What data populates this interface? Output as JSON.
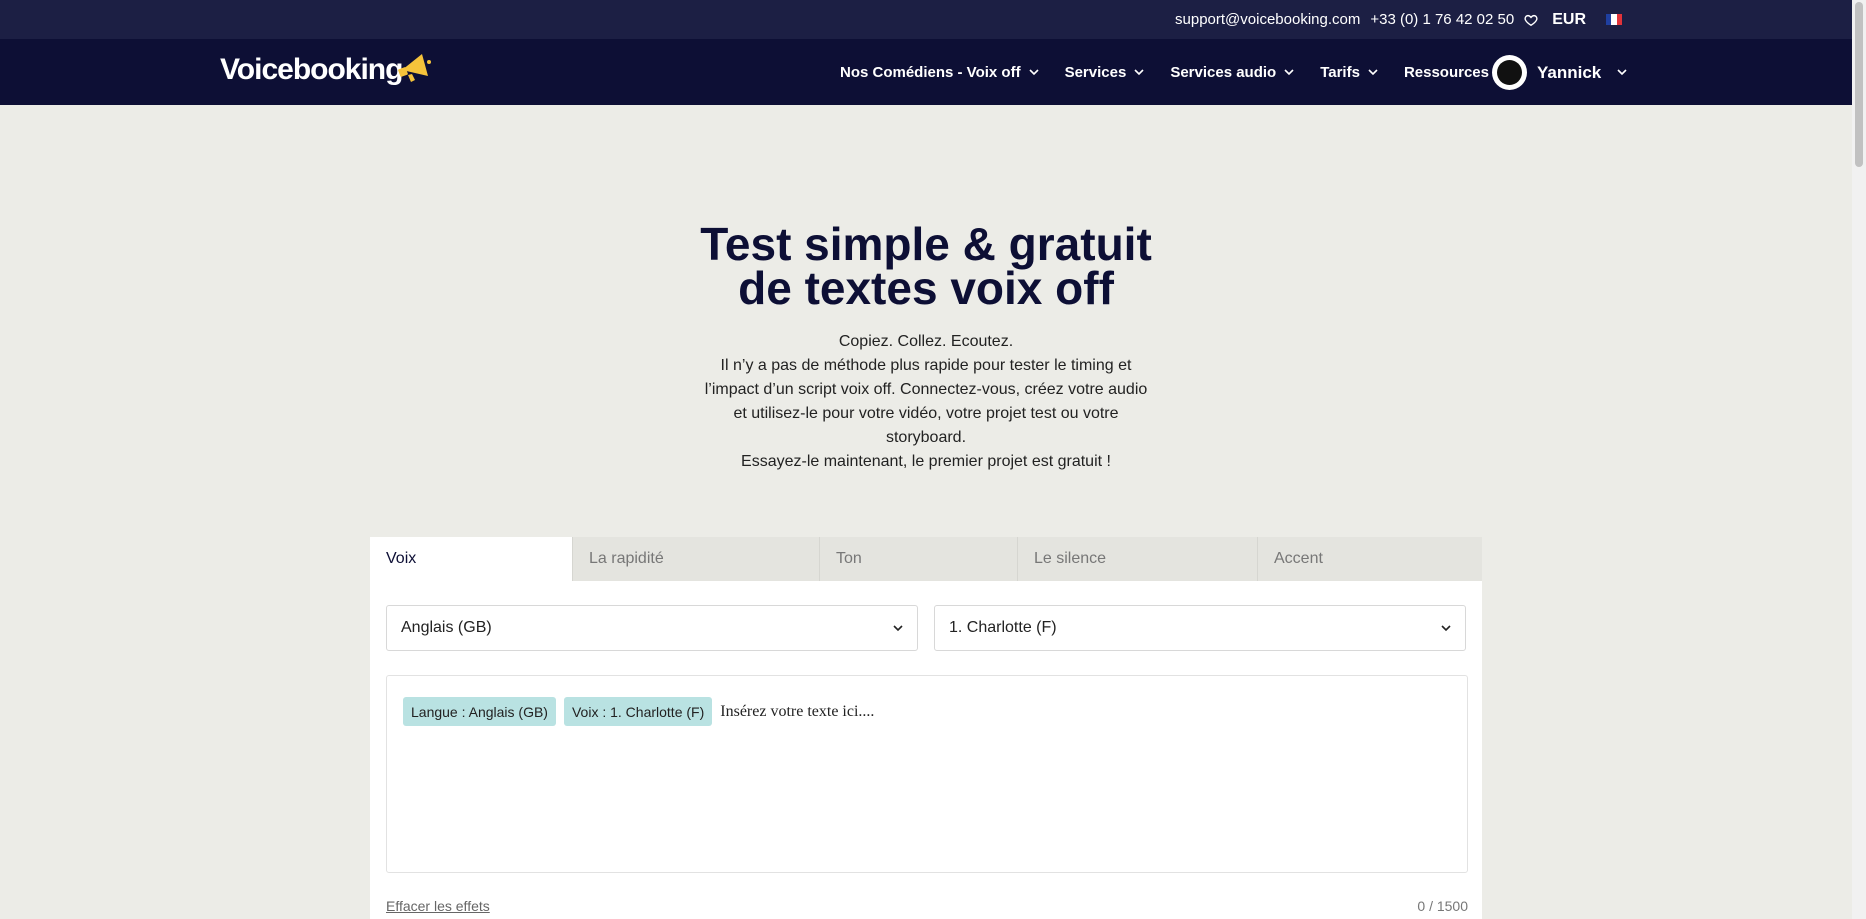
{
  "topbar": {
    "email": "support@voicebooking.com",
    "phone": "+33 (0) 1 76 42 02 50",
    "currency": "EUR"
  },
  "logo": {
    "text": "Voicebooking"
  },
  "nav": {
    "items": [
      {
        "label": "Nos Comédiens - Voix off"
      },
      {
        "label": "Services"
      },
      {
        "label": "Services audio"
      },
      {
        "label": "Tarifs"
      },
      {
        "label": "Ressources"
      }
    ],
    "user_name": "Yannick"
  },
  "hero": {
    "title_line1": "Test simple & gratuit",
    "title_line2": "de textes voix off",
    "line1": "Copiez. Collez. Ecoutez.",
    "line2": "Il n’y a pas de méthode plus rapide pour tester le timing et l’impact d’un script voix off. Connectez-vous, créez votre audio et utilisez-le pour votre vidéo, votre projet test ou votre storyboard.",
    "line3": "Essayez-le maintenant, le premier projet est gratuit !"
  },
  "tool": {
    "tabs": [
      {
        "label": "Voix"
      },
      {
        "label": "La rapidité"
      },
      {
        "label": "Ton"
      },
      {
        "label": "Le silence"
      },
      {
        "label": "Accent"
      }
    ],
    "language_select": "Anglais (GB)",
    "voice_select": "1. Charlotte (F)",
    "chip_language": "Langue : Anglais (GB)",
    "chip_voice": "Voix : 1. Charlotte (F)",
    "placeholder": "Insérez votre texte ici....",
    "clear_effects": "Effacer les effets",
    "counter": "0 / 1500"
  },
  "colors": {
    "topbar_bg": "#1c1f44",
    "nav_bg": "#0d0f35",
    "page_bg": "#ecece7",
    "logo_accent": "#f5c33b",
    "chip_bg": "#b9e2e2"
  },
  "icons": [
    "heart-icon",
    "france-flag-icon",
    "megaphone-icon",
    "chevron-down-icon"
  ]
}
